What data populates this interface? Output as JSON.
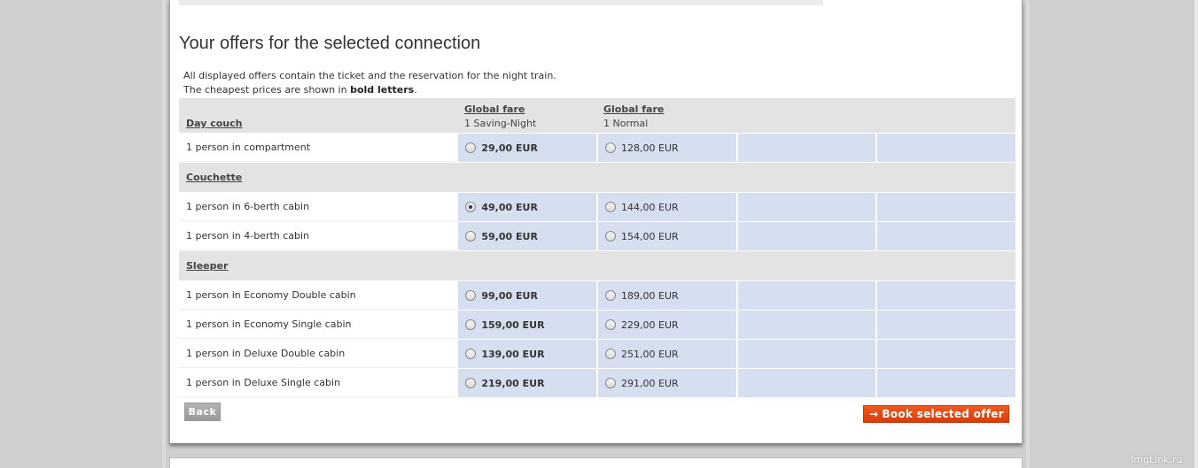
{
  "title": "Your offers for the selected connection",
  "intro": {
    "line1": "All displayed offers contain the ticket and the reservation for the night train.",
    "line2_prefix": "The cheapest prices are shown in ",
    "line2_bold": "bold letters",
    "line2_suffix": "."
  },
  "fares": [
    {
      "name": "Global fare",
      "detail": "1 Saving-Night"
    },
    {
      "name": "Global fare",
      "detail": "1 Normal"
    }
  ],
  "categories": {
    "day_couch": {
      "label": "Day couch",
      "rows": [
        {
          "label": "1 person in compartment",
          "price1": "29,00 EUR",
          "price2": "128,00 EUR"
        }
      ]
    },
    "couchette": {
      "label": "Couchette",
      "rows": [
        {
          "label": "1 person in 6-berth cabin",
          "price1": "49,00 EUR",
          "price2": "144,00 EUR"
        },
        {
          "label": "1 person in 4-berth cabin",
          "price1": "59,00 EUR",
          "price2": "154,00 EUR"
        }
      ]
    },
    "sleeper": {
      "label": "Sleeper",
      "rows": [
        {
          "label": "1 person in Economy Double cabin",
          "price1": "99,00 EUR",
          "price2": "189,00 EUR"
        },
        {
          "label": "1 person in Economy Single cabin",
          "price1": "159,00 EUR",
          "price2": "229,00 EUR"
        },
        {
          "label": "1 person in Deluxe Double cabin",
          "price1": "139,00 EUR",
          "price2": "251,00 EUR"
        },
        {
          "label": "1 person in Deluxe Single cabin",
          "price1": "219,00 EUR",
          "price2": "291,00 EUR"
        }
      ]
    }
  },
  "selected_offer": "1 person in 6-berth cabin — 49,00 EUR",
  "buttons": {
    "back": "Back",
    "book": "Book selected offer",
    "book_arrow": "→"
  },
  "watermark": "ImgLink.ru",
  "colors": {
    "price_cell": "#d6dff0",
    "header_bg": "#e3e3e3",
    "book_button": "#e04a14",
    "back_button": "#a6a6a6"
  }
}
